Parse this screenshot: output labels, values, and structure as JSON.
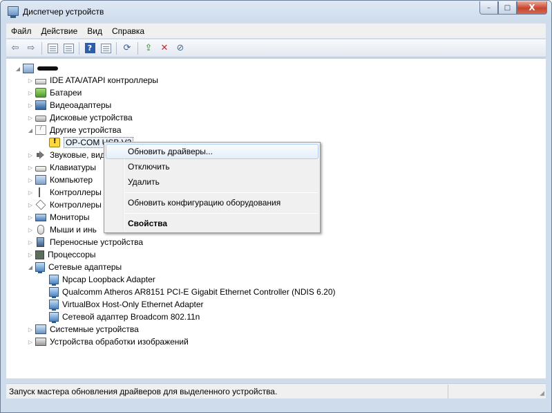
{
  "window": {
    "title": "Диспетчер устройств",
    "caption_minimize": "–",
    "caption_maximize": "□",
    "caption_close": "X"
  },
  "menubar": {
    "items": [
      "Файл",
      "Действие",
      "Вид",
      "Справка"
    ]
  },
  "toolbar": {
    "icons": [
      "back-arrow-icon",
      "forward-arrow-icon",
      "show-hide-tree-icon",
      "properties-icon",
      "help-icon",
      "view-icon",
      "scan-hardware-icon",
      "update-driver-icon",
      "uninstall-icon",
      "disable-icon"
    ]
  },
  "tree": {
    "root_label": "",
    "items": [
      {
        "label": "IDE ATA/ATAPI контроллеры",
        "icon": "ide-controller-icon",
        "expanded": false
      },
      {
        "label": "Батареи",
        "icon": "battery-icon",
        "expanded": false
      },
      {
        "label": "Видеоадаптеры",
        "icon": "display-adapter-icon",
        "expanded": false
      },
      {
        "label": "Дисковые устройства",
        "icon": "disk-drive-icon",
        "expanded": false
      },
      {
        "label": "Другие устройства",
        "icon": "other-devices-icon",
        "expanded": true
      },
      {
        "label": "OP-COM USB V2",
        "icon": "warning-device-icon",
        "child": true
      },
      {
        "label": "Звуковые, вид",
        "icon": "sound-icon",
        "expanded": false
      },
      {
        "label": "Клавиатуры",
        "icon": "keyboard-icon",
        "expanded": false
      },
      {
        "label": "Компьютер",
        "icon": "computer-icon",
        "expanded": false
      },
      {
        "label": "Контроллеры",
        "icon": "usb-controller-icon",
        "expanded": false
      },
      {
        "label": "Контроллеры",
        "icon": "storage-controller-icon",
        "expanded": false
      },
      {
        "label": "Мониторы",
        "icon": "monitor-icon",
        "expanded": false
      },
      {
        "label": "Мыши и инь",
        "icon": "mouse-icon",
        "expanded": false
      },
      {
        "label": "Переносные устройства",
        "icon": "portable-device-icon",
        "expanded": false
      },
      {
        "label": "Процессоры",
        "icon": "processor-icon",
        "expanded": false
      },
      {
        "label": "Сетевые адаптеры",
        "icon": "network-adapter-icon",
        "expanded": true
      },
      {
        "label": "Npcap Loopback Adapter",
        "icon": "network-adapter-icon",
        "child": true
      },
      {
        "label": "Qualcomm Atheros AR8151 PCI-E Gigabit Ethernet Controller (NDIS 6.20)",
        "icon": "network-adapter-icon",
        "child": true
      },
      {
        "label": "VirtualBox Host-Only Ethernet Adapter",
        "icon": "network-adapter-icon",
        "child": true
      },
      {
        "label": "Сетевой адаптер Broadcom 802.11n",
        "icon": "network-adapter-icon",
        "child": true
      },
      {
        "label": "Системные устройства",
        "icon": "system-devices-icon",
        "expanded": false
      },
      {
        "label": "Устройства обработки изображений",
        "icon": "imaging-device-icon",
        "expanded": false
      }
    ]
  },
  "context_menu": {
    "update_drivers": "Обновить драйверы...",
    "disable": "Отключить",
    "uninstall": "Удалить",
    "scan_hardware": "Обновить конфигурацию оборудования",
    "properties": "Свойства"
  },
  "statusbar": {
    "text": "Запуск мастера обновления драйверов для выделенного устройства."
  }
}
